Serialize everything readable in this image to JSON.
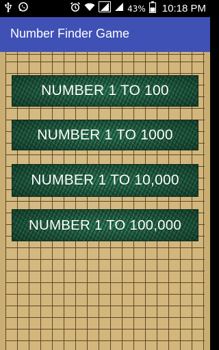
{
  "status_bar": {
    "left_icons": [
      "usb-icon",
      "whatsapp-icon"
    ],
    "right_icons": [
      "alarm-icon",
      "wifi-icon",
      "signal-icon",
      "signal-icon",
      "battery-icon"
    ],
    "battery_percent": "43%",
    "time": "10:18 PM"
  },
  "app_bar": {
    "title": "Number Finder Game",
    "color": "#3f51b5"
  },
  "buttons": [
    {
      "label": "NUMBER 1 TO 100"
    },
    {
      "label": "NUMBER 1 TO 1000"
    },
    {
      "label": "NUMBER 1 TO 10,000"
    },
    {
      "label": "NUMBER 1 TO 100,000"
    }
  ],
  "colors": {
    "board": "#d2b67c",
    "grid_line": "#5e4724",
    "button": "#1f5a40"
  }
}
